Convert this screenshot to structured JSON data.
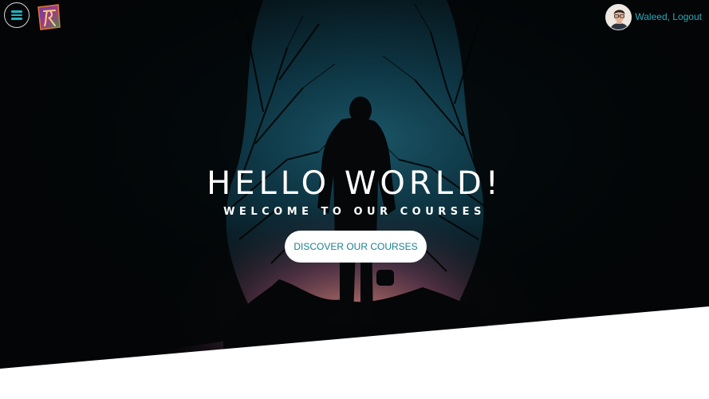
{
  "header": {
    "menu_icon": "hamburger-menu-icon",
    "logo_icon": "brand-logo",
    "avatar_icon": "user-avatar",
    "user_link": "Waleed, Logout"
  },
  "hero": {
    "title": "HELLO WORLD!",
    "subtitle": "WELCOME TO OUR COURSES",
    "cta_label": "DISCOVER OUR COURSES"
  },
  "colors": {
    "accent": "#1fb5c4",
    "link": "#2aa9bb",
    "cta_text": "#1a7f90",
    "hero_dark": "#05090c",
    "sky_glow": "#0f3a48",
    "horizon_glow": "#b26a6a"
  }
}
